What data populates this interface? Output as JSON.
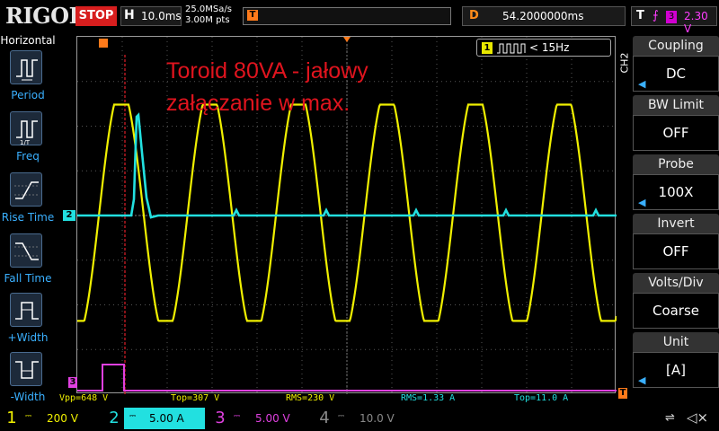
{
  "header": {
    "brand": "RIGOL",
    "run_status": "STOP",
    "horizontal_label": "H",
    "timebase": "10.0ms",
    "sample_rate": "25.0MSa/s",
    "memory_depth": "3.00M pts",
    "trigger_marker": "T",
    "delay_label": "D",
    "delay_value": "54.2000000ms",
    "trigger_label": "T",
    "trigger_edge_icon": "rising-falling-edge-icon",
    "trigger_source": "3",
    "trigger_level": "2.30 V"
  },
  "left_menu": {
    "title": "Horizontal",
    "items": [
      {
        "label": "Period",
        "icon": "period-icon"
      },
      {
        "label": "Freq",
        "icon": "frequency-icon"
      },
      {
        "label": "Rise Time",
        "icon": "rise-time-icon"
      },
      {
        "label": "Fall Time",
        "icon": "fall-time-icon"
      },
      {
        "label": "+Width",
        "icon": "positive-width-icon"
      },
      {
        "label": "-Width",
        "icon": "negative-width-icon"
      }
    ]
  },
  "screen": {
    "annotation_line1": "Toroid 80VA - jałowy",
    "annotation_line2": "załączanie w max.",
    "freq_counter_channel": "1",
    "freq_counter_value": "< 15Hz",
    "ch2_marker": "2",
    "ch3_marker": "3",
    "trigger_level_marker": "T"
  },
  "measurements": [
    {
      "text": "Vpp=648 V",
      "color": "#f0f000"
    },
    {
      "text": "Top=307 V",
      "color": "#f0f000"
    },
    {
      "text": "RMS=230 V",
      "color": "#f0f000"
    },
    {
      "text": "RMS=1.33 A",
      "color": "#22e0e0"
    },
    {
      "text": "Top=11.0 A",
      "color": "#22e0e0"
    }
  ],
  "right_menu": {
    "channel_label": "CH2",
    "items": [
      {
        "head": "Coupling",
        "value": "DC"
      },
      {
        "head": "BW Limit",
        "value": "OFF"
      },
      {
        "head": "Probe",
        "value": "100X"
      },
      {
        "head": "Invert",
        "value": "OFF"
      },
      {
        "head": "Volts/Div",
        "value": "Coarse"
      },
      {
        "head": "Unit",
        "value": "[A]"
      }
    ]
  },
  "bottom_bar": {
    "channels": [
      {
        "num": "1",
        "scale": "200 V",
        "color": "#f0f000",
        "active": false
      },
      {
        "num": "2",
        "scale": "5.00 A",
        "color": "#22e0e0",
        "active": true
      },
      {
        "num": "3",
        "scale": "5.00 V",
        "color": "#e040e0",
        "active": false
      },
      {
        "num": "4",
        "scale": "10.0 V",
        "color": "#8a8a8a",
        "active": false
      }
    ],
    "usb_icon": "usb-icon",
    "sound_icon": "speaker-muted-icon"
  },
  "colors": {
    "ch1": "#f0f000",
    "ch2": "#22e0e0",
    "ch3": "#e040e0",
    "trigger": "#ff7a1a",
    "accent": "#3ab0ff"
  }
}
